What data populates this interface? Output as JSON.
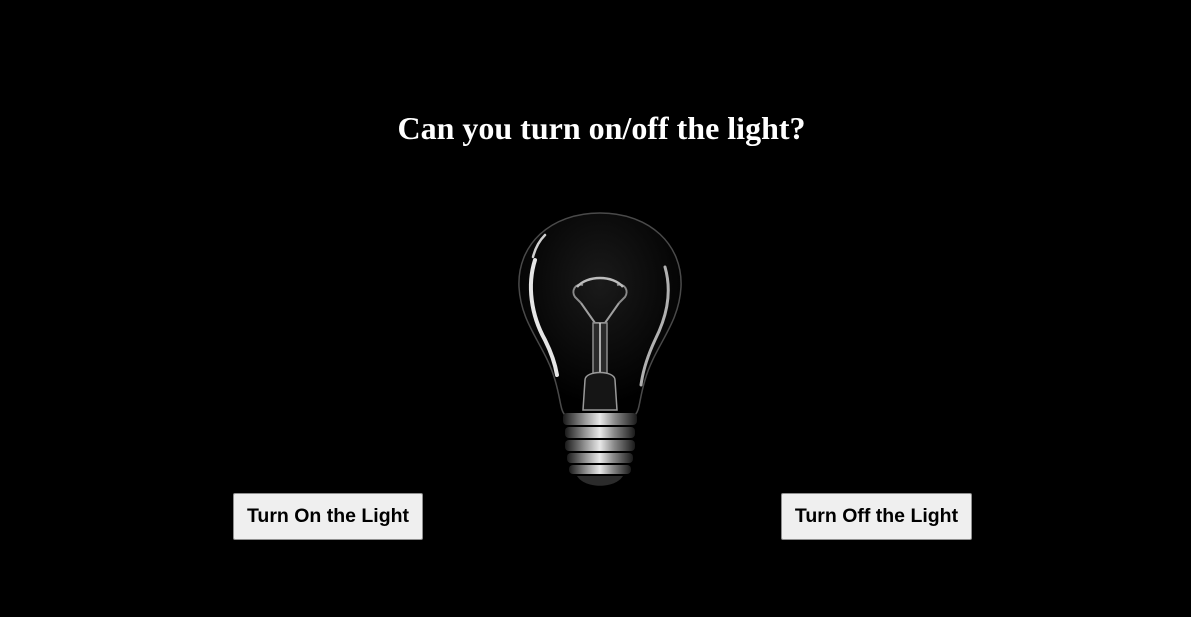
{
  "page": {
    "title": "Can you turn on/off the light?",
    "background_color": "#000000",
    "title_color": "#ffffff"
  },
  "bulb": {
    "state": "off",
    "icon": "light-bulb-icon"
  },
  "buttons": {
    "turn_on_label": "Turn On the Light",
    "turn_off_label": "Turn Off the Light",
    "button_background": "#efefef"
  }
}
